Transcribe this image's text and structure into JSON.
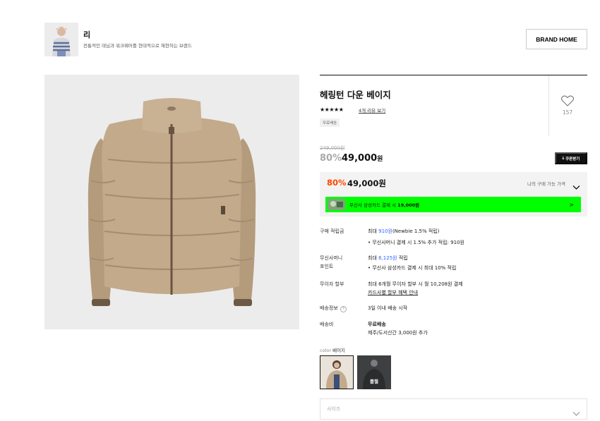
{
  "brand": {
    "name": "리",
    "description": "전통적인 데님과 워크웨어를 현대적으로 재현하는 브랜드",
    "home_button": "BRAND HOME"
  },
  "product": {
    "title": "헤링턴 다운 베이지",
    "rating_stars": "★★★★★",
    "rating": 4.5,
    "review_link": "4개 리뷰 보기",
    "shipping_badge": "무료배송",
    "like_count": "157",
    "original_price": "249,000원",
    "discount_rate": "80%",
    "sale_price": "49,000",
    "sale_price_unit": "원",
    "coupon_button": "쿠폰받기",
    "coupon_icon": "download-icon"
  },
  "best_price": {
    "discount_rate": "80%",
    "price": "49,000원",
    "my_price_label": "나의 구매 가능 가격",
    "card_banner_prefix": "무신사 삼성카드 결제 시",
    "card_banner_price": "19,000원",
    "card_banner_arrow": ">"
  },
  "info": {
    "points": {
      "label": "구매 적립금",
      "line_prefix": "최대",
      "line_amount": "910원",
      "line_suffix": "(Newbie 1.5% 적립)",
      "bullet": "•  무신사머니 결제 시 1.5% 추가 적립: 910원"
    },
    "money": {
      "label_line1": "무신사머니",
      "label_line2": "포인트",
      "line_prefix": "최대",
      "line_amount": "6,125원",
      "line_suffix": "적립",
      "bullet": "•  무신사 삼성카드 결제 시 최대 10% 적립"
    },
    "installment": {
      "label": "무이자 할부",
      "line1": "최대 6개월 무이자 할부 시 월 10,208원 결제",
      "link": "카드사별 할부 혜택 안내"
    },
    "delivery": {
      "label": "배송정보",
      "help_icon": "?",
      "value": "3일 이내 배송 시작"
    },
    "shipping_fee": {
      "label": "배송비",
      "value": "무료배송",
      "note": "제주/도서산간 3,000원 추가"
    }
  },
  "color": {
    "label": "color",
    "selected": "베이지",
    "options": [
      {
        "name": "베이지",
        "swatch": "#e9e3da"
      },
      {
        "name": "품절",
        "swatch": "#3d3f41"
      }
    ]
  },
  "size": {
    "placeholder": "사이즈"
  },
  "colors": {
    "accent_discount": "#ff4800",
    "card_banner": "#00ff00",
    "link_blue": "#2a66ff"
  }
}
